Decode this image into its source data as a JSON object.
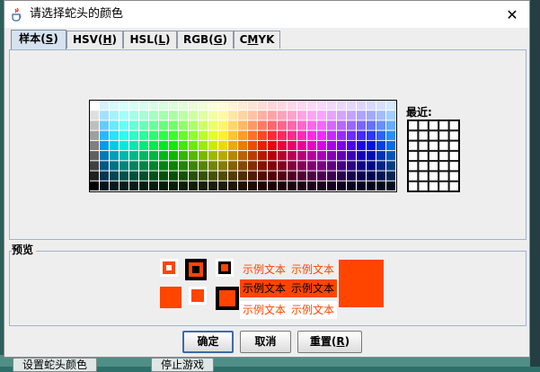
{
  "window": {
    "title": "请选择蛇头的颜色",
    "close_glyph": "✕"
  },
  "tabs": [
    {
      "label": "样本",
      "mnemonic": "S",
      "active": true
    },
    {
      "label": "HSV",
      "mnemonic": "H",
      "active": false
    },
    {
      "label": "HSL",
      "mnemonic": "L",
      "active": false
    },
    {
      "label": "RGB",
      "mnemonic": "G",
      "active": false
    },
    {
      "label": "CMYK",
      "mnemonic": "M",
      "active": false
    }
  ],
  "swatches": {
    "recent_label": "最近:",
    "main_cols": 31,
    "main_rows": 9,
    "recent_cols": 5,
    "recent_rows": 7
  },
  "preview": {
    "title": "预览",
    "sample_text": "示例文本",
    "selected_color": "#ff4500",
    "text_row_bg": "#ff4500"
  },
  "buttons": {
    "ok": "确定",
    "cancel": "取消",
    "reset_label": "重置",
    "reset_mnemonic": "R"
  },
  "background": {
    "left_button": "设置蛇头颜色",
    "right_button": "停止游戏"
  },
  "colors": {
    "accent": "#ff4500",
    "tab_active": "#d6e2ef",
    "border": "#9fb3c8"
  }
}
